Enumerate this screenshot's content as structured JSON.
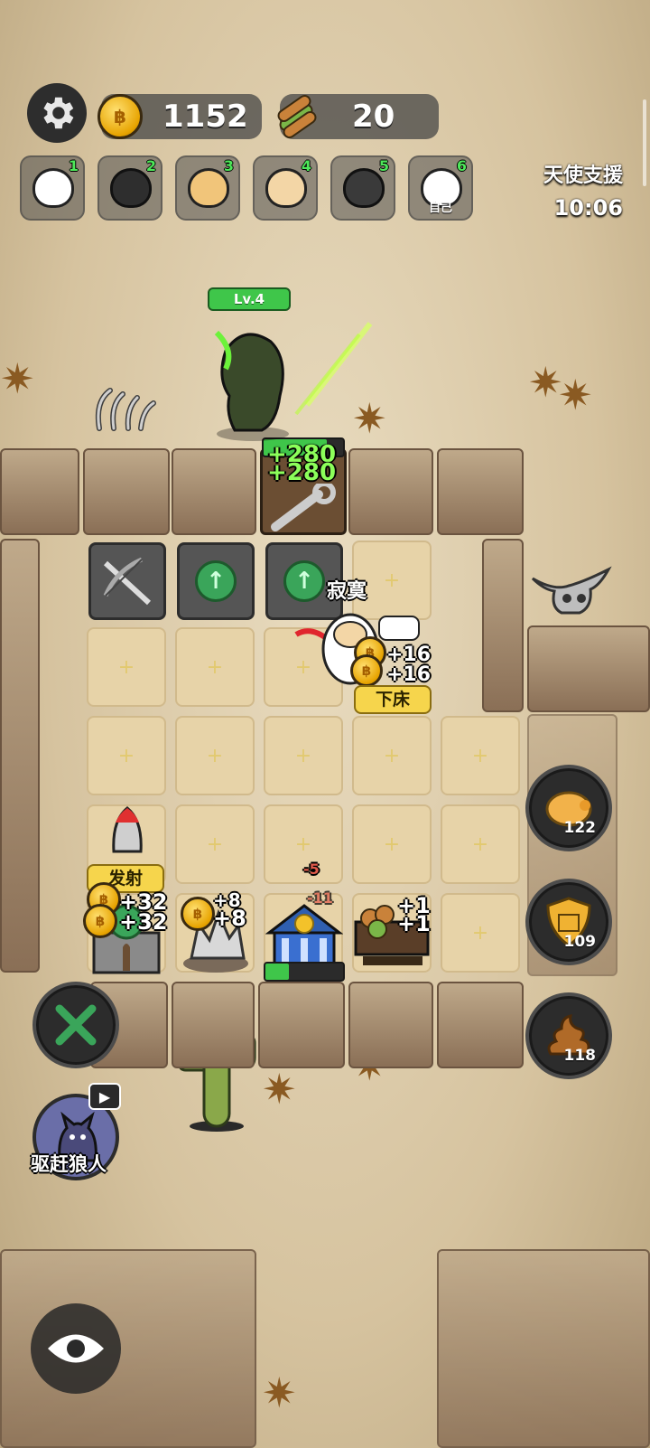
{
  "hud": {
    "coins": "1152",
    "wood": "20",
    "settings_icon": "gear-icon"
  },
  "team": [
    {
      "number": "1",
      "color": "#ffffff",
      "label": ""
    },
    {
      "number": "2",
      "color": "#2e2e2e",
      "label": ""
    },
    {
      "number": "3",
      "color": "#f1c57a",
      "label": ""
    },
    {
      "number": "4",
      "color": "#f3d6a6",
      "label": ""
    },
    {
      "number": "5",
      "color": "#3a3a3a",
      "label": ""
    },
    {
      "number": "6",
      "color": "#ffffff",
      "label": "自己"
    }
  ],
  "support": {
    "title": "天使支援",
    "timer": "10:06"
  },
  "enemy": {
    "level": "Lv.4",
    "damage_1": "+280",
    "damage_2": "+280"
  },
  "player": {
    "name": "寂寞",
    "gain_1": "+16",
    "gain_2": "+16",
    "action_label": "下床"
  },
  "buildings": {
    "rocket_label": "发射",
    "tower_gain_1": "+32",
    "tower_gain_2": "+32",
    "ore_gain_1": "+8",
    "ore_gain_2": "+8",
    "bank_loss_1": "-5",
    "bank_loss_2": "-11",
    "lumber_gain_1": "+1",
    "lumber_gain_2": "+1",
    "bank_progress": 0.3
  },
  "side_buttons": {
    "piggy_count": "122",
    "shield_count": "109",
    "poop_count": "118"
  },
  "actions": {
    "repair_icon": "wrench-hammer-icon",
    "wolf_label": "驱赶狼人",
    "view_icon": "eye-icon"
  },
  "colors": {
    "accent_green": "#3fc64a",
    "label_yellow": "#f6d54c",
    "hud_dark": "#2d2d2d"
  }
}
